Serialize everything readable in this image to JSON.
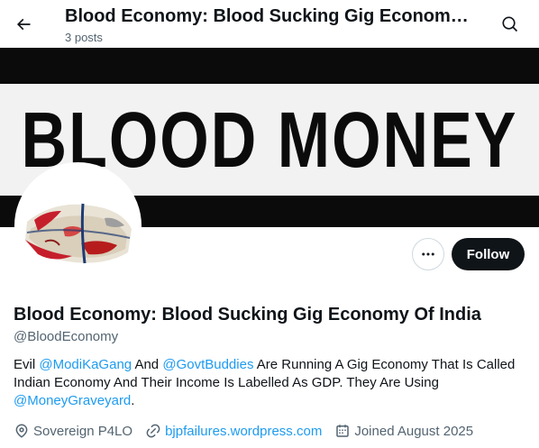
{
  "header": {
    "title": "Blood Economy: Blood Sucking Gig Economy Of India",
    "posts": "3 posts"
  },
  "banner": {
    "text": "BLOOD MONEY"
  },
  "actions": {
    "follow_label": "Follow"
  },
  "profile": {
    "name": "Blood Economy: Blood Sucking Gig Economy Of India",
    "handle": "@BloodEconomy",
    "bio": {
      "t1": "Evil ",
      "m1": "@ModiKaGang",
      "t2": " And ",
      "m2": "@GovtBuddies",
      "t3": " Are Running A Gig Economy That Is Called Indian Economy And Their Income Is Labelled As GDP. They Are Using ",
      "m3": "@MoneyGraveyard",
      "t4": "."
    },
    "location": "Sovereign P4LO",
    "website": "bjpfailures.wordpress.com",
    "joined": "Joined August 2025"
  },
  "icons": [
    "back-arrow-icon",
    "search-icon",
    "more-icon",
    "location-pin-icon",
    "link-icon",
    "calendar-icon"
  ],
  "colors": {
    "accent": "#1d9bf0",
    "text": "#0f1419",
    "secondary": "#536471"
  }
}
